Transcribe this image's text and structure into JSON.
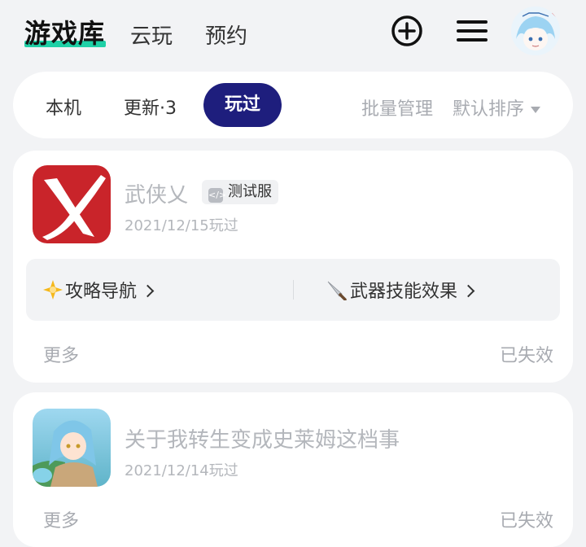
{
  "header": {
    "brand": "游戏库",
    "tabs": [
      {
        "label": "云玩"
      },
      {
        "label": "预约"
      }
    ],
    "icons": [
      "add-circle-icon",
      "menu-icon",
      "avatar"
    ]
  },
  "filter": {
    "tabs": [
      {
        "label": "本机"
      },
      {
        "label": "更新·3"
      },
      {
        "label": "玩过",
        "active": true
      }
    ],
    "batch_manage": "批量管理",
    "sort": "默认排序"
  },
  "games": [
    {
      "title": "武侠乂",
      "tag": "测试服",
      "date": "2021/12/15玩过",
      "links": [
        {
          "label": "攻略导航",
          "icon": "sparkle-icon"
        },
        {
          "label": "武器技能效果",
          "icon": "knife-icon"
        }
      ],
      "more": "更多",
      "status": "已失效"
    },
    {
      "title": "关于我转生变成史莱姆这档事",
      "date": "2021/12/14玩过",
      "more": "更多",
      "status": "已失效"
    }
  ],
  "colors": {
    "background": "#f2f3f5",
    "brand_underline": "#1fd0a6",
    "active_tab": "#1e1e7d",
    "muted_text": "#a8abb1",
    "wuxia_icon": "#c9242a"
  }
}
